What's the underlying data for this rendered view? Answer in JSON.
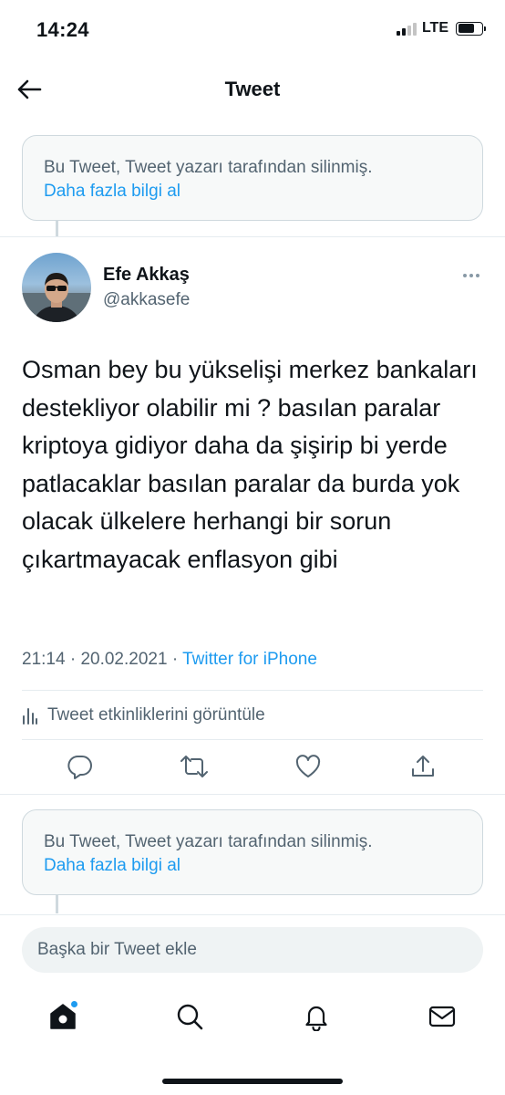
{
  "status_bar": {
    "time": "14:24",
    "network": "LTE"
  },
  "header": {
    "title": "Tweet"
  },
  "deleted_notice": {
    "text": "Bu Tweet, Tweet yazarı tarafından silinmiş.",
    "link": "Daha fazla bilgi al"
  },
  "tweet": {
    "author_name": "Efe Akkaş",
    "author_handle": "@akkasefe",
    "text": "Osman bey bu yükselişi merkez bankaları destekliyor olabilir mi ? basılan paralar kriptoya gidiyor daha da şişirip bi yerde patlacaklar basılan paralar da burda yok olacak ülkelere herhangi bir sorun çıkartmayacak enflasyon gibi",
    "time": "21:14",
    "date": "20.02.2021",
    "separator": "·",
    "source": "Twitter for iPhone",
    "analytics_label": "Tweet etkinliklerini görüntüle"
  },
  "reply_notice": {
    "text": "Bu Tweet, Tweet yazarı tarafından silinmiş.",
    "link": "Daha fazla bilgi al"
  },
  "reply_bar": {
    "placeholder": "Başka bir Tweet ekle"
  },
  "tab_bar": {
    "items": [
      "home-icon",
      "search-icon",
      "notifications-icon",
      "messages-icon"
    ],
    "home_has_new": true
  },
  "colors": {
    "accent": "#1d9bf0",
    "text": "#0f1419",
    "secondary": "#536471",
    "border": "#cfd9de"
  }
}
